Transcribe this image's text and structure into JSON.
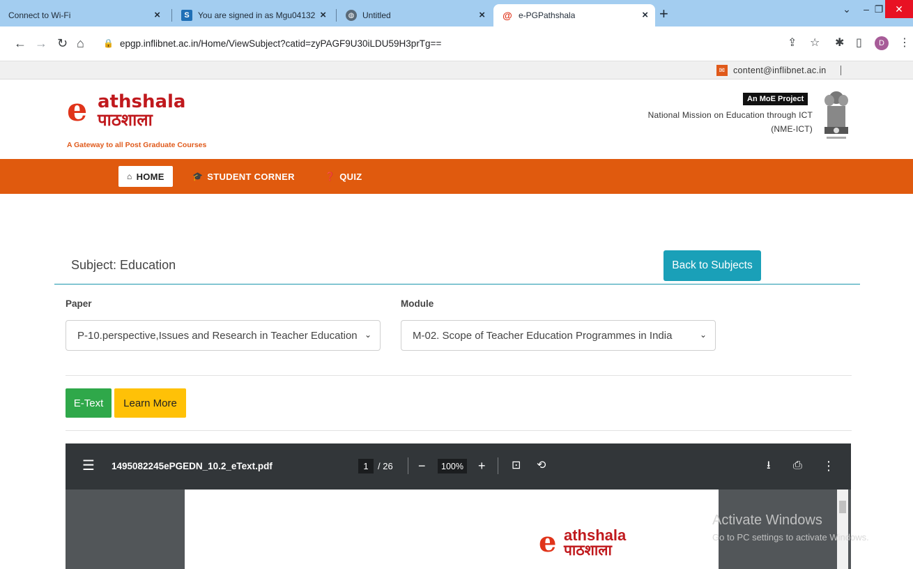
{
  "browser": {
    "tabs": [
      {
        "title": "Connect to Wi-Fi",
        "icon": "none"
      },
      {
        "title": "You are signed in as Mgu04132",
        "icon": "s-favicon"
      },
      {
        "title": "Untitled",
        "icon": "globe-favicon"
      },
      {
        "title": "e-PGPathshala",
        "icon": "epg-favicon",
        "active": true
      }
    ],
    "url": "epgp.inflibnet.ac.in/Home/ViewSubject?catid=zyPAGF9U30iLDU59H3prTg==",
    "profile_initial": "D",
    "colors": {
      "tabstrip": "#a3cdf0",
      "close": "#e81123"
    }
  },
  "topbar": {
    "email": "content@inflibnet.ac.in"
  },
  "header": {
    "logo_text_en": "athshala",
    "logo_text_hi": "पाठशाला",
    "tagline": "A Gateway to all Post Graduate Courses",
    "badge": "An MoE Project",
    "mission_line1": "National Mission on Education through ICT",
    "mission_line2": "(NME-ICT)"
  },
  "nav": {
    "items": [
      {
        "label": "HOME",
        "icon": "home-icon",
        "active": true
      },
      {
        "label": "STUDENT CORNER",
        "icon": "graduation-cap-icon"
      },
      {
        "label": "QUIZ",
        "icon": "question-circle-icon"
      }
    ],
    "color": "#e05a0e"
  },
  "subject": {
    "title": "Subject: Education",
    "back_label": "Back to Subjects"
  },
  "filters": {
    "paper_label": "Paper",
    "paper_value": "P-10.perspective,Issues and Research in Teacher Education",
    "module_label": "Module",
    "module_value": "M-02. Scope of Teacher Education Programmes in India"
  },
  "actions": {
    "etext": "E-Text",
    "learn_more": "Learn More"
  },
  "pdf": {
    "filename": "1495082245ePGEDN_10.2_eText.pdf",
    "page": "1",
    "total": "/ 26",
    "zoom": "100%",
    "page_logo_en": "athshala",
    "page_logo_hi": "पाठशाला"
  },
  "watermark": {
    "line1": "Activate Windows",
    "line2": "Go to PC settings to activate Windows."
  }
}
